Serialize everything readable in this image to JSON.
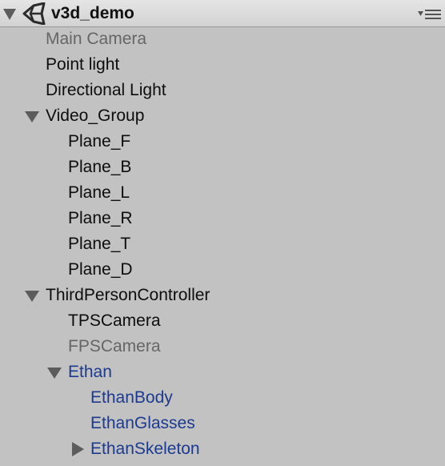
{
  "header": {
    "scene_name": "v3d_demo",
    "logo_icon": "unity-logo-icon",
    "menu_icon": "options-menu-icon"
  },
  "hierarchy": [
    {
      "label": "Main Camera",
      "style": "inactive",
      "expandable": false
    },
    {
      "label": "Point light",
      "style": "normal",
      "expandable": false
    },
    {
      "label": "Directional Light",
      "style": "normal",
      "expandable": false
    },
    {
      "label": "Video_Group",
      "style": "normal",
      "expandable": true,
      "expanded": true
    },
    {
      "label": "Plane_F",
      "style": "normal",
      "expandable": false
    },
    {
      "label": "Plane_B",
      "style": "normal",
      "expandable": false
    },
    {
      "label": "Plane_L",
      "style": "normal",
      "expandable": false
    },
    {
      "label": "Plane_R",
      "style": "normal",
      "expandable": false
    },
    {
      "label": "Plane_T",
      "style": "normal",
      "expandable": false
    },
    {
      "label": "Plane_D",
      "style": "normal",
      "expandable": false
    },
    {
      "label": "ThirdPersonController",
      "style": "normal",
      "expandable": true,
      "expanded": true
    },
    {
      "label": "TPSCamera",
      "style": "normal",
      "expandable": false
    },
    {
      "label": "FPSCamera",
      "style": "inactive",
      "expandable": false
    },
    {
      "label": "Ethan",
      "style": "prefab",
      "expandable": true,
      "expanded": true
    },
    {
      "label": "EthanBody",
      "style": "prefab",
      "expandable": false
    },
    {
      "label": "EthanGlasses",
      "style": "prefab",
      "expandable": false
    },
    {
      "label": "EthanSkeleton",
      "style": "prefab",
      "expandable": true,
      "expanded": false
    }
  ],
  "colors": {
    "background": "#c2c2c2",
    "normal_text": "#0d0d0d",
    "inactive_text": "#666666",
    "prefab_text": "#1c3a8f",
    "foldout_arrow": "#5c5c5c"
  }
}
